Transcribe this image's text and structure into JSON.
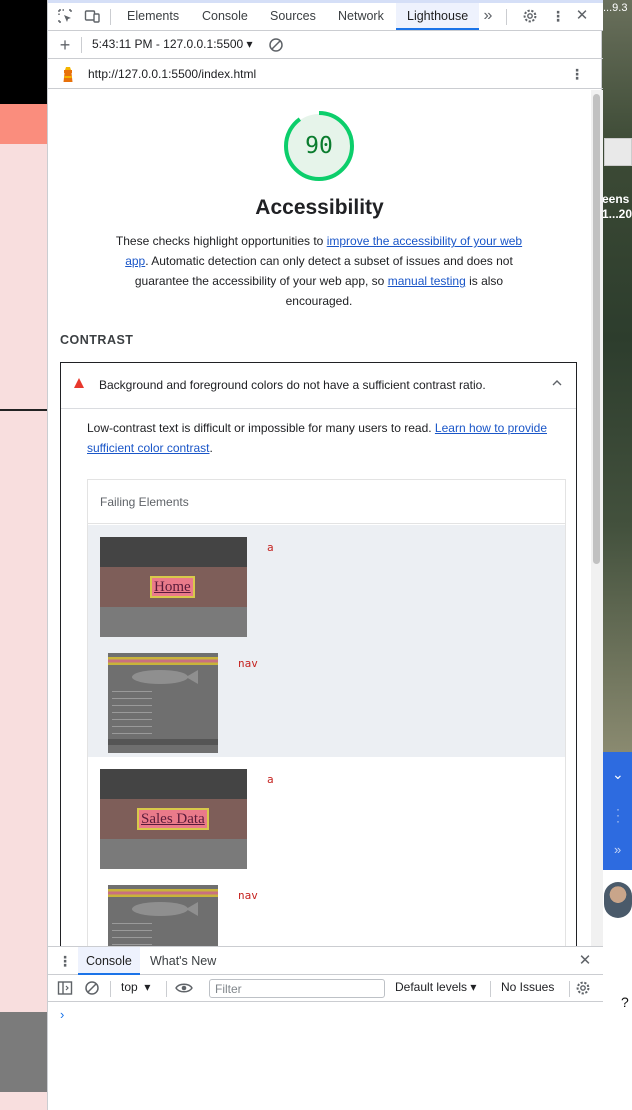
{
  "background": {
    "right_version": "...9.3",
    "right_title_line1": "eens",
    "right_title_line2": "1...20",
    "right_help": "?"
  },
  "devtools": {
    "tabs": [
      "Elements",
      "Console",
      "Sources",
      "Network",
      "Lighthouse"
    ],
    "active_tab": "Lighthouse",
    "report_selector": "5:43:11 PM - 127.0.0.1:5500",
    "url": "http://127.0.0.1:5500/index.html"
  },
  "report": {
    "score": "90",
    "score_color": "#0a7c2e",
    "category": "Accessibility",
    "desc_prefix": "These checks highlight opportunities to ",
    "desc_link1": "improve the accessibility of your web app",
    "desc_middle": ". Automatic detection can only detect a subset of issues and does not guarantee the accessibility of your web app, so ",
    "desc_link2": "manual testing",
    "desc_suffix": " is also encouraged.",
    "group_title": "CONTRAST",
    "audit": {
      "title": "Background and foreground colors do not have a sufficient contrast ratio.",
      "desc_prefix": "Low-contrast text is difficult or impossible for many users to read. ",
      "desc_link": "Learn how to provide sufficient color contrast",
      "desc_suffix": ".",
      "table_header": "Failing Elements",
      "items": [
        {
          "snippet": "a",
          "thumb_text": "Home",
          "sub_snippet": "nav"
        },
        {
          "snippet": "a",
          "thumb_text": "Sales Data",
          "sub_snippet": "nav"
        }
      ]
    }
  },
  "drawer": {
    "tabs": [
      "Console",
      "What's New"
    ],
    "context": "top",
    "filter_placeholder": "Filter",
    "levels": "Default levels",
    "issues": "No Issues",
    "prompt": "›"
  },
  "colors": {
    "accent": "#1a73e8",
    "pass": "#0a7c2e",
    "fail": "#e8382d",
    "link": "#1a56c8"
  }
}
